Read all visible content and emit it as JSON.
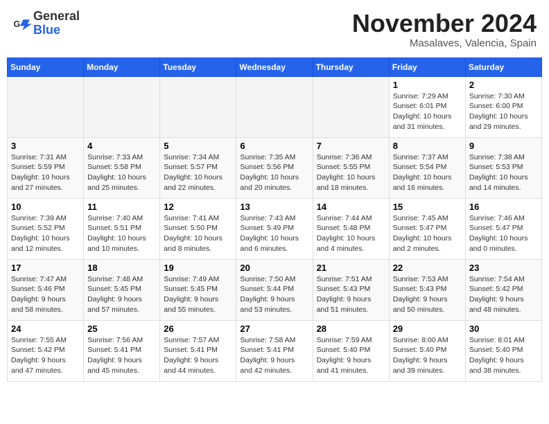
{
  "header": {
    "logo_general": "General",
    "logo_blue": "Blue",
    "month_title": "November 2024",
    "location": "Masalaves, Valencia, Spain"
  },
  "calendar": {
    "headers": [
      "Sunday",
      "Monday",
      "Tuesday",
      "Wednesday",
      "Thursday",
      "Friday",
      "Saturday"
    ],
    "weeks": [
      [
        {
          "day": "",
          "info": ""
        },
        {
          "day": "",
          "info": ""
        },
        {
          "day": "",
          "info": ""
        },
        {
          "day": "",
          "info": ""
        },
        {
          "day": "",
          "info": ""
        },
        {
          "day": "1",
          "info": "Sunrise: 7:29 AM\nSunset: 6:01 PM\nDaylight: 10 hours\nand 31 minutes."
        },
        {
          "day": "2",
          "info": "Sunrise: 7:30 AM\nSunset: 6:00 PM\nDaylight: 10 hours\nand 29 minutes."
        }
      ],
      [
        {
          "day": "3",
          "info": "Sunrise: 7:31 AM\nSunset: 5:59 PM\nDaylight: 10 hours\nand 27 minutes."
        },
        {
          "day": "4",
          "info": "Sunrise: 7:33 AM\nSunset: 5:58 PM\nDaylight: 10 hours\nand 25 minutes."
        },
        {
          "day": "5",
          "info": "Sunrise: 7:34 AM\nSunset: 5:57 PM\nDaylight: 10 hours\nand 22 minutes."
        },
        {
          "day": "6",
          "info": "Sunrise: 7:35 AM\nSunset: 5:56 PM\nDaylight: 10 hours\nand 20 minutes."
        },
        {
          "day": "7",
          "info": "Sunrise: 7:36 AM\nSunset: 5:55 PM\nDaylight: 10 hours\nand 18 minutes."
        },
        {
          "day": "8",
          "info": "Sunrise: 7:37 AM\nSunset: 5:54 PM\nDaylight: 10 hours\nand 16 minutes."
        },
        {
          "day": "9",
          "info": "Sunrise: 7:38 AM\nSunset: 5:53 PM\nDaylight: 10 hours\nand 14 minutes."
        }
      ],
      [
        {
          "day": "10",
          "info": "Sunrise: 7:39 AM\nSunset: 5:52 PM\nDaylight: 10 hours\nand 12 minutes."
        },
        {
          "day": "11",
          "info": "Sunrise: 7:40 AM\nSunset: 5:51 PM\nDaylight: 10 hours\nand 10 minutes."
        },
        {
          "day": "12",
          "info": "Sunrise: 7:41 AM\nSunset: 5:50 PM\nDaylight: 10 hours\nand 8 minutes."
        },
        {
          "day": "13",
          "info": "Sunrise: 7:43 AM\nSunset: 5:49 PM\nDaylight: 10 hours\nand 6 minutes."
        },
        {
          "day": "14",
          "info": "Sunrise: 7:44 AM\nSunset: 5:48 PM\nDaylight: 10 hours\nand 4 minutes."
        },
        {
          "day": "15",
          "info": "Sunrise: 7:45 AM\nSunset: 5:47 PM\nDaylight: 10 hours\nand 2 minutes."
        },
        {
          "day": "16",
          "info": "Sunrise: 7:46 AM\nSunset: 5:47 PM\nDaylight: 10 hours\nand 0 minutes."
        }
      ],
      [
        {
          "day": "17",
          "info": "Sunrise: 7:47 AM\nSunset: 5:46 PM\nDaylight: 9 hours\nand 58 minutes."
        },
        {
          "day": "18",
          "info": "Sunrise: 7:48 AM\nSunset: 5:45 PM\nDaylight: 9 hours\nand 57 minutes."
        },
        {
          "day": "19",
          "info": "Sunrise: 7:49 AM\nSunset: 5:45 PM\nDaylight: 9 hours\nand 55 minutes."
        },
        {
          "day": "20",
          "info": "Sunrise: 7:50 AM\nSunset: 5:44 PM\nDaylight: 9 hours\nand 53 minutes."
        },
        {
          "day": "21",
          "info": "Sunrise: 7:51 AM\nSunset: 5:43 PM\nDaylight: 9 hours\nand 51 minutes."
        },
        {
          "day": "22",
          "info": "Sunrise: 7:53 AM\nSunset: 5:43 PM\nDaylight: 9 hours\nand 50 minutes."
        },
        {
          "day": "23",
          "info": "Sunrise: 7:54 AM\nSunset: 5:42 PM\nDaylight: 9 hours\nand 48 minutes."
        }
      ],
      [
        {
          "day": "24",
          "info": "Sunrise: 7:55 AM\nSunset: 5:42 PM\nDaylight: 9 hours\nand 47 minutes."
        },
        {
          "day": "25",
          "info": "Sunrise: 7:56 AM\nSunset: 5:41 PM\nDaylight: 9 hours\nand 45 minutes."
        },
        {
          "day": "26",
          "info": "Sunrise: 7:57 AM\nSunset: 5:41 PM\nDaylight: 9 hours\nand 44 minutes."
        },
        {
          "day": "27",
          "info": "Sunrise: 7:58 AM\nSunset: 5:41 PM\nDaylight: 9 hours\nand 42 minutes."
        },
        {
          "day": "28",
          "info": "Sunrise: 7:59 AM\nSunset: 5:40 PM\nDaylight: 9 hours\nand 41 minutes."
        },
        {
          "day": "29",
          "info": "Sunrise: 8:00 AM\nSunset: 5:40 PM\nDaylight: 9 hours\nand 39 minutes."
        },
        {
          "day": "30",
          "info": "Sunrise: 8:01 AM\nSunset: 5:40 PM\nDaylight: 9 hours\nand 38 minutes."
        }
      ]
    ]
  }
}
